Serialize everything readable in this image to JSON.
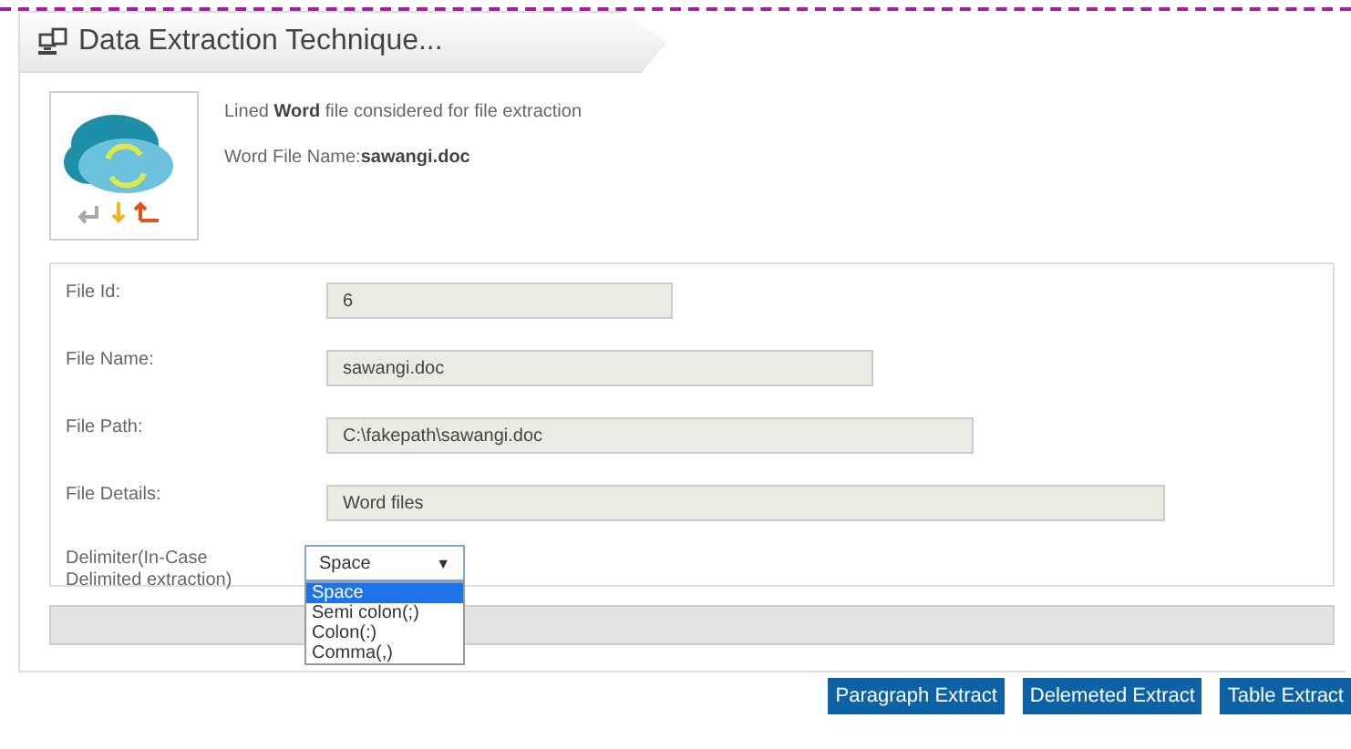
{
  "header": {
    "title": "Data Extraction Technique..."
  },
  "info": {
    "description": "Lined **Word** file considered for file extraction",
    "file_name_line": "Word File Name:**sawangi.doc**"
  },
  "fields": [
    {
      "label": "File Id:",
      "value": "6"
    },
    {
      "label": "File Name:",
      "value": "sawangi.doc"
    },
    {
      "label": "File Path:",
      "value": "C:\\fakepath\\sawangi.doc"
    },
    {
      "label": "File Details:",
      "value": "Word files"
    }
  ],
  "delimiter": {
    "label": "Delimiter(In-Case Delimited extraction)",
    "value": "Space",
    "expanded": true,
    "arrow": "▼",
    "options": [
      {
        "label": "Space",
        "selected": true
      },
      {
        "label": "Semi colon(;)",
        "selected": false
      },
      {
        "label": "Colon(:)",
        "selected": false
      },
      {
        "label": "Comma(,)",
        "selected": false
      }
    ]
  },
  "buttons": [
    "Paragraph Extract",
    "Delemeted Extract",
    "Table Extract"
  ]
}
